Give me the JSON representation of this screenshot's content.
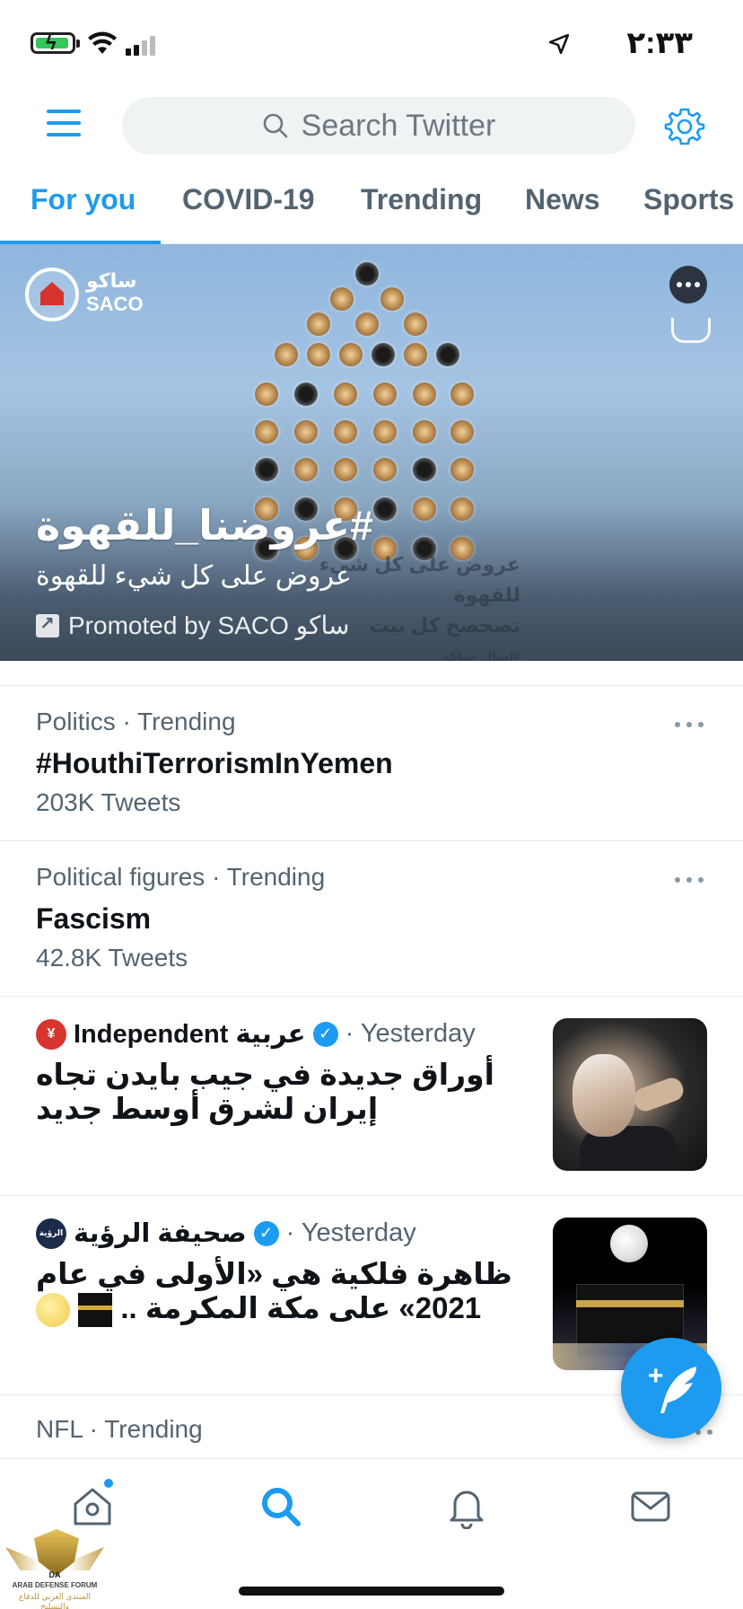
{
  "status_bar": {
    "time": "٢:٣٣"
  },
  "header": {
    "search_placeholder": "Search Twitter"
  },
  "tabs": [
    {
      "label": "For you",
      "active": true
    },
    {
      "label": "COVID-19",
      "active": false
    },
    {
      "label": "Trending",
      "active": false
    },
    {
      "label": "News",
      "active": false
    },
    {
      "label": "Sports",
      "active": false
    }
  ],
  "promo": {
    "logo_text": "ساكو",
    "logo_text_latin": "SACO",
    "headline": "#عروضنا_للقهوة",
    "subline": "عروض على كل شيء للقهوة",
    "image_text_1": "عروض على كل شيء للقهوة",
    "image_text_2": "تصحصح كل بيت",
    "image_text_3": "#اسال_ساكو",
    "promoted": "Promoted by SACO ساكو"
  },
  "trends": [
    {
      "meta": "Politics · Trending",
      "title": "#HouthiTerrorismInYemen",
      "count": "203K Tweets"
    },
    {
      "meta": "Political figures · Trending",
      "title": "Fascism",
      "count": "42.8K Tweets"
    }
  ],
  "news": [
    {
      "source": "Independent عربية",
      "time": "· Yesterday",
      "title": "أوراق جديدة في جيب بايدن تجاه إيران لشرق أوسط جديد",
      "logo_color": "#d6342d"
    },
    {
      "source": "صحيفة الرؤية",
      "time": "· Yesterday",
      "title": "ظاهرة فلكية هي «الأولى في عام 2021» على مكة المكرمة ..",
      "logo_color": "#1b2b4a",
      "logo_text": "الرؤية"
    }
  ],
  "partial_trend": {
    "meta": "NFL · Trending"
  },
  "watermark": {
    "title": "ARAB DEFENSE FORUM",
    "subtitle": "المنتدى العربي للدفاع والتسليح",
    "monogram": "DA"
  },
  "colors": {
    "accent": "#1d9bf0",
    "text": "#0f1419",
    "secondary": "#536471"
  }
}
